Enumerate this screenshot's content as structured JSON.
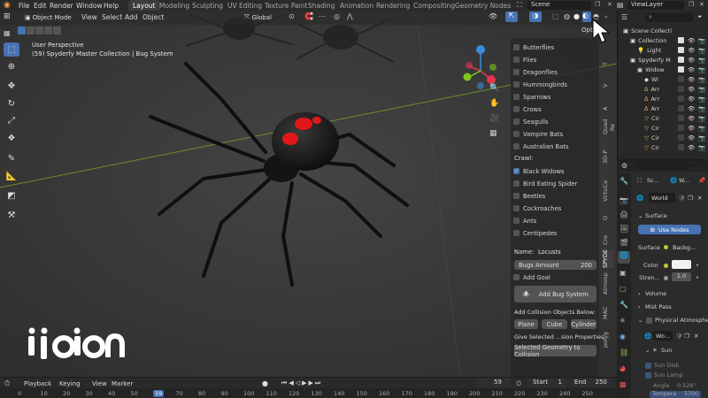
{
  "topbar": {
    "menus": [
      "File",
      "Edit",
      "Render",
      "Window",
      "Help"
    ],
    "workspaces": [
      "Layout",
      "Modeling",
      "Sculpting",
      "UV Editing",
      "Texture Paint",
      "Shading",
      "Animation",
      "Rendering",
      "Compositing",
      "Geometry Nodes"
    ],
    "active_workspace": "Layout",
    "scene": "Scene",
    "view_layer": "ViewLayer"
  },
  "viewport": {
    "mode": "Object Mode",
    "menus": [
      "View",
      "Select",
      "Add",
      "Object"
    ],
    "transform": "Global",
    "perspective": "User Perspective",
    "collection_info": "(59) Spyderfy Master Collection | Bug System",
    "tooltip": "Opti"
  },
  "npanel": {
    "fly_items": [
      {
        "label": "Butterflies",
        "checked": false
      },
      {
        "label": "Flies",
        "checked": false
      },
      {
        "label": "Dragonflies",
        "checked": false
      },
      {
        "label": "Hummingbirds",
        "checked": false
      },
      {
        "label": "Sparrows",
        "checked": false
      },
      {
        "label": "Crows",
        "checked": false
      },
      {
        "label": "Seagulls",
        "checked": false
      },
      {
        "label": "Vampire Bats",
        "checked": false
      },
      {
        "label": "Australian Bats",
        "checked": false
      }
    ],
    "crawl_heading": "Crawl:",
    "crawl_items": [
      {
        "label": "Black Widows",
        "checked": true
      },
      {
        "label": "Bird Eating Spider",
        "checked": false
      },
      {
        "label": "Beetles",
        "checked": false
      },
      {
        "label": "Cockroaches",
        "checked": false
      },
      {
        "label": "Ants",
        "checked": false
      },
      {
        "label": "Centipedes",
        "checked": false
      }
    ],
    "name_label": "Name:",
    "name_value": "Locusts",
    "bugs_amount_label": "Bugs Amount",
    "bugs_amount_value": "200",
    "add_goal": "Add Goal",
    "add_bug_system": "Add Bug System",
    "collision_heading": "Add Collision Objects Below:",
    "collision_buttons": [
      "Plane",
      "Cube",
      "Cylinder"
    ],
    "give_selected": "Give Selected ...sion Properties:",
    "selected_geo": "Selected Geometry to Collision"
  },
  "vtabs": [
    "T",
    "V",
    "A",
    "Quad Re",
    "3D-P",
    "VirtuCa",
    "O",
    "Cre",
    "SPYDE",
    "Atmosp",
    "MAC",
    "polyg"
  ],
  "outliner": {
    "search_placeholder": "",
    "rows": [
      {
        "label": "Scene Collecti",
        "indent": 0
      },
      {
        "label": "Collection",
        "indent": 1
      },
      {
        "label": "Light",
        "indent": 2
      },
      {
        "label": "Spyderfy M",
        "indent": 1
      },
      {
        "label": "Widow",
        "indent": 2
      },
      {
        "label": "Wi",
        "indent": 3
      },
      {
        "label": "Arr",
        "indent": 3
      },
      {
        "label": "Arr",
        "indent": 3
      },
      {
        "label": "Arr",
        "indent": 3
      },
      {
        "label": "Cir",
        "indent": 3
      },
      {
        "label": "Cir",
        "indent": 3
      },
      {
        "label": "Cir",
        "indent": 3
      },
      {
        "label": "Cir",
        "indent": 3
      }
    ]
  },
  "properties": {
    "context": "Sc...",
    "world_tab": "W...",
    "world_name": "World",
    "surface_heading": "Surface",
    "use_nodes": "Use Nodes",
    "surface_label": "Surface",
    "surface_value": "Backg...",
    "color_label": "Color",
    "strength_label": "Stren...",
    "strength_value": "1.0",
    "volume": "Volume",
    "mist_pass": "Mist Pass",
    "physical_atmosphere": "Physical Atmospher",
    "world_slot": "Wo...",
    "sun": "Sun",
    "sun_disk": "Sun Disk",
    "sun_lamp": "Sun Lamp",
    "angle_label": "Angle",
    "angle_value": "0.526°",
    "temp_label": "Tempera",
    "temp_value": "5700"
  },
  "timeline": {
    "menus": [
      "Playback",
      "Keying",
      "View",
      "Marker"
    ],
    "current_frame": "59",
    "start_label": "Start",
    "start_value": "1",
    "end_label": "End",
    "end_value": "250",
    "ticks": [
      "0",
      "10",
      "20",
      "30",
      "40",
      "50",
      "59",
      "70",
      "80",
      "90",
      "100",
      "110",
      "120",
      "130",
      "140",
      "150",
      "160",
      "170",
      "180",
      "190",
      "200",
      "210",
      "220",
      "230",
      "240",
      "250"
    ]
  },
  "watermark": "ijigen",
  "colors": {
    "accent": "#4772b3",
    "viewport_bg": "#3a3a3a",
    "spider_mark": "#e01818",
    "gizmo_x": "#e3364d",
    "gizmo_y": "#7fc71c",
    "gizmo_z": "#3a8ce0"
  }
}
